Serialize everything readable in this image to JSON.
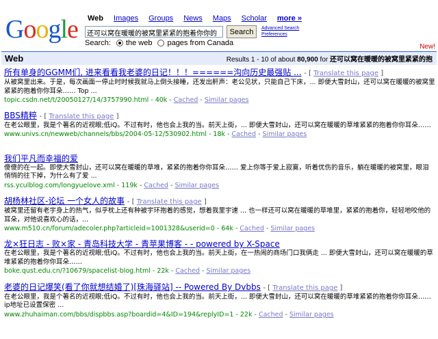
{
  "logo_letters": [
    "G",
    "o",
    "o",
    "g",
    "l",
    "e"
  ],
  "tabs": [
    {
      "label": "Web",
      "active": true
    },
    {
      "label": "Images"
    },
    {
      "label": "Groups"
    },
    {
      "label": "News"
    },
    {
      "label": "Maps"
    },
    {
      "label": "Scholar"
    },
    {
      "label": "more »",
      "more": true
    }
  ],
  "search": {
    "value": "还可以窝在暖暖的被窝里紧紧的抱着你你的",
    "button": "Search"
  },
  "advanced": {
    "line1": "Advanced Search",
    "line2": "Preferences"
  },
  "scope": {
    "label": "Search:",
    "opt1": "the web",
    "opt2": "pages from Canada"
  },
  "new_label": "New!",
  "bar": {
    "label": "Web",
    "results_prefix": "Results 1 - 10 of about",
    "count": "80,900",
    "for_word": "for",
    "query": "还可以窝在暖暖的被窝里紧紧的抱"
  },
  "results": [
    {
      "title": "所有单身的GGMM们, 进来看看我老婆的日记！！！======沟向历史最强贴 ...",
      "translate": "Translate this page",
      "snippet": "从被窝里出来。于是，每次画面一停止时时候我就马上倒头接睡，还发出鼾声：老公见状，只能自己下床，... 即便大雪封山，还可以窝在暖暖的被窝里紧紧的抱着你你耳朵…… Top ...",
      "url": "topic.csdn.net/t/20050127/14/3757990.html - 40k -",
      "cached": "Cached",
      "similar": "Similar pages"
    },
    {
      "title": "BBS精粹",
      "translate": "Translate this page",
      "snippet": "在老公眼里，我是个著名的近视眼;低iQ。不过有时，他也会上我的当。前天上街，... 即便大雪封山，还可以窝在暖暖的草堆紧紧的抱着你你耳朵……",
      "url": "www.univs.cn/newweb/channels/bbs/2004-05-12/530902.html - 18k -",
      "cached": "Cached",
      "similar": "Similar pages"
    },
    {
      "title": "我们平凡而幸福的爱",
      "translate": "",
      "snippet": "傻傻的在一起。即使大雪封山，还可以窝在暖暖的草堆，紧紧的抱着你你耳朵…… 爱上你等于爱上寂寞，听着优伤的音乐，躺在暖暖的被窝里，眼泪悄悄的往下掉，为什么有了爱 ...",
      "url": "rss.yculblog.com/longyuelove.xml - 119k -",
      "cached": "Cached",
      "similar": "Similar pages"
    },
    {
      "title": "胡杨林社区-论坛 一个女人的故事",
      "translate": "Translate this page",
      "snippet": "被窝里还留有老宇身上的热气，似乎枕上还有种被宇环抱着的感觉，想着我里宇速 ... 也一样还可以窝在暖暖的草堆里，紧紧的抱着你，轻轻地咬他的耳朵，对他说喜欢心的话，...",
      "url": "www.m510.cn/forum/adecoler.php?articleid=1001328&userid=0 - 64k -",
      "cached": "Cached",
      "similar": "Similar pages"
    },
    {
      "title": "龙×狂日志 - 败×家 - 青岛科技大学 - 青苹果博客 - - powered by X-Space",
      "translate": "",
      "snippet": "在老公眼里，我是个著名的近视眼;低iQ。不过有时，他也会上我的当。前天上街，在一热闹的商场门口我俩走 ... 即便大雪封山，还可以窝在暖暖的草堆紧紧的抱着你你耳朵……",
      "url": "boke.qust.edu.cn/?10679/spacelist-blog.html - 22k -",
      "cached": "Cached",
      "similar": "Similar pages"
    },
    {
      "title": "老婆的日记爆笑(看了你就想结婚了)[珠海驿站] -- Powered By Dvbbs",
      "translate": "Translate this page",
      "snippet": "在老公眼里，我是个著名的近视眼;低iQ。不过有时，他也会上我的当。前天上街，... 即便大雪封山，还可以窝在暖暖的草堆紧紧的抱着你你耳朵…… ip地址已设置保密 ...",
      "url": "www.zhuhaiman.com/bbs/dispbbs.asp?boardid=4&ID=194&replyID=1 - 22k -",
      "cached": "Cached",
      "similar": "Similar pages"
    }
  ]
}
